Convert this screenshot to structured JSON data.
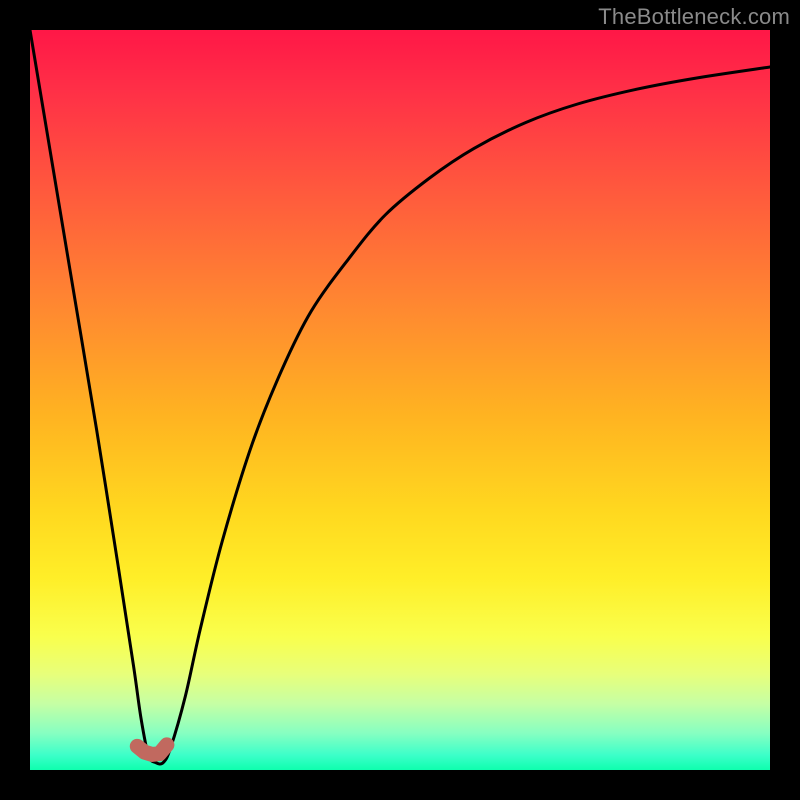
{
  "watermark": "TheBottleneck.com",
  "chart_data": {
    "type": "line",
    "title": "",
    "xlabel": "",
    "ylabel": "",
    "xlim": [
      0,
      100
    ],
    "ylim": [
      0,
      100
    ],
    "grid": false,
    "legend": false,
    "series": [
      {
        "name": "bottleneck-curve",
        "x": [
          0,
          3,
          6,
          9,
          12,
          14,
          15,
          16,
          17,
          18,
          19,
          21,
          23,
          26,
          30,
          34,
          38,
          43,
          48,
          54,
          60,
          67,
          74,
          82,
          90,
          100
        ],
        "y": [
          100,
          82,
          64,
          46,
          27,
          14,
          7,
          2,
          1,
          1,
          3,
          10,
          19,
          31,
          44,
          54,
          62,
          69,
          75,
          80,
          84,
          87.5,
          90,
          92,
          93.5,
          95
        ]
      }
    ],
    "marker": {
      "name": "highlight-segment",
      "color": "#c1695f",
      "x": [
        14.5,
        15.5,
        16.5,
        17.5,
        18.5
      ],
      "y": [
        3.2,
        2.4,
        2.1,
        2.2,
        3.4
      ]
    },
    "gradient_stops": [
      {
        "pos": 0,
        "color": "#ff1747"
      },
      {
        "pos": 8,
        "color": "#ff2f47"
      },
      {
        "pos": 22,
        "color": "#ff5a3d"
      },
      {
        "pos": 38,
        "color": "#ff8a30"
      },
      {
        "pos": 52,
        "color": "#ffb321"
      },
      {
        "pos": 65,
        "color": "#ffd81f"
      },
      {
        "pos": 74,
        "color": "#ffee28"
      },
      {
        "pos": 82,
        "color": "#f9ff4d"
      },
      {
        "pos": 87,
        "color": "#e8ff7a"
      },
      {
        "pos": 91,
        "color": "#c6ffa4"
      },
      {
        "pos": 95,
        "color": "#87ffc1"
      },
      {
        "pos": 98,
        "color": "#3cffc9"
      },
      {
        "pos": 100,
        "color": "#0effae"
      }
    ]
  }
}
